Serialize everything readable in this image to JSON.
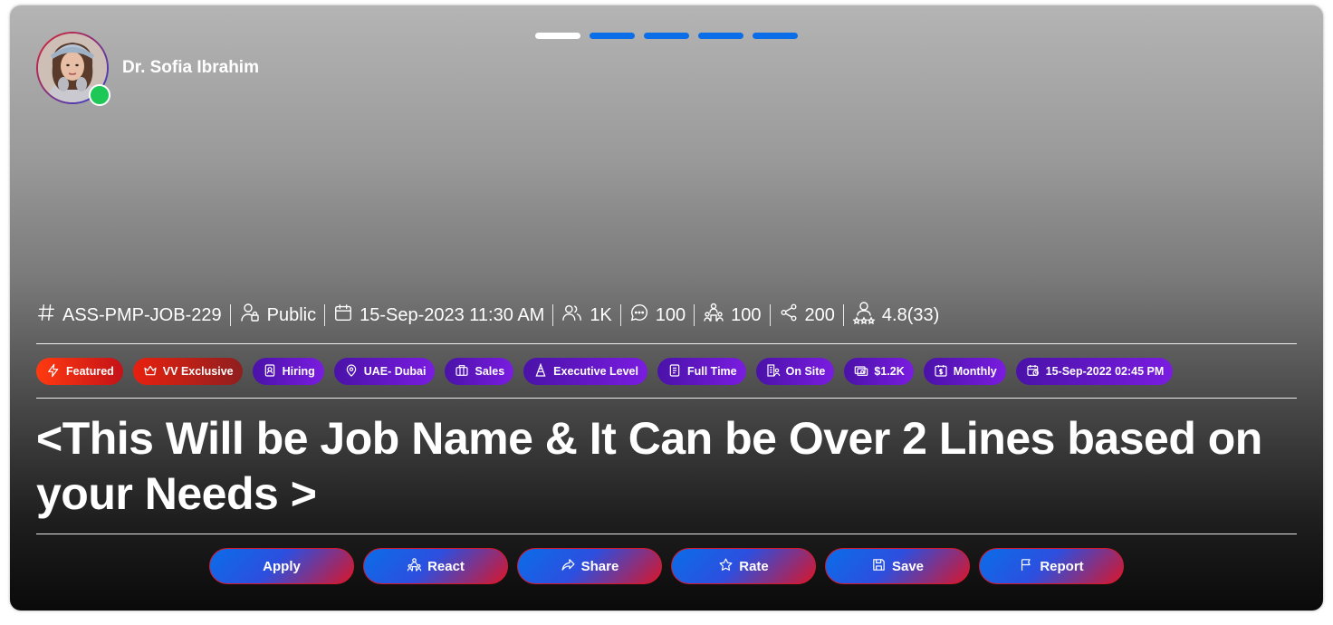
{
  "profile": {
    "name": "Dr. Sofia Ibrahim",
    "status": "online"
  },
  "story_progress": {
    "total": 5,
    "active_index": 0
  },
  "meta": [
    {
      "icon": "hash-icon",
      "label": "ASS-PMP-JOB-229"
    },
    {
      "icon": "user-lock-icon",
      "label": "Public"
    },
    {
      "icon": "calendar-icon",
      "label": "15-Sep-2023 11:30 AM"
    },
    {
      "icon": "users-icon",
      "label": "1K"
    },
    {
      "icon": "comment-icon",
      "label": "100"
    },
    {
      "icon": "reactions-icon",
      "label": "100"
    },
    {
      "icon": "share-nodes-icon",
      "label": "200"
    },
    {
      "icon": "rating-user-icon",
      "label": "4.8(33)"
    }
  ],
  "tags": [
    {
      "icon": "bolt-icon",
      "label": "Featured",
      "style": "red"
    },
    {
      "icon": "crown-icon",
      "label": "VV Exclusive",
      "style": "red2"
    },
    {
      "icon": "badge-icon",
      "label": "Hiring",
      "style": "purple"
    },
    {
      "icon": "location-pin-icon",
      "label": "UAE- Dubai",
      "style": "purple"
    },
    {
      "icon": "briefcase-icon",
      "label": "Sales",
      "style": "purple"
    },
    {
      "icon": "level-icon",
      "label": "Executive Level",
      "style": "purple"
    },
    {
      "icon": "document-icon",
      "label": "Full Time",
      "style": "purple"
    },
    {
      "icon": "building-person-icon",
      "label": "On Site",
      "style": "purple"
    },
    {
      "icon": "money-icon",
      "label": "$1.2K",
      "style": "purple"
    },
    {
      "icon": "dollar-calendar-icon",
      "label": "Monthly",
      "style": "purple"
    },
    {
      "icon": "calendar-clock-icon",
      "label": "15-Sep-2022 02:45 PM",
      "style": "purple"
    }
  ],
  "job_title": "<This Will be Job Name & It Can be Over 2 Lines based on your Needs >",
  "actions": [
    {
      "icon": "",
      "label": "Apply"
    },
    {
      "icon": "reactions-icon",
      "label": "React"
    },
    {
      "icon": "share-arrow-icon",
      "label": "Share"
    },
    {
      "icon": "star-icon",
      "label": "Rate"
    },
    {
      "icon": "save-disk-icon",
      "label": "Save"
    },
    {
      "icon": "flag-icon",
      "label": "Report"
    }
  ],
  "colors": {
    "accent_blue": "#0a6ee8",
    "accent_red": "#d61a2e",
    "tag_purple": "#7a1ce0",
    "online_green": "#1dc857"
  }
}
